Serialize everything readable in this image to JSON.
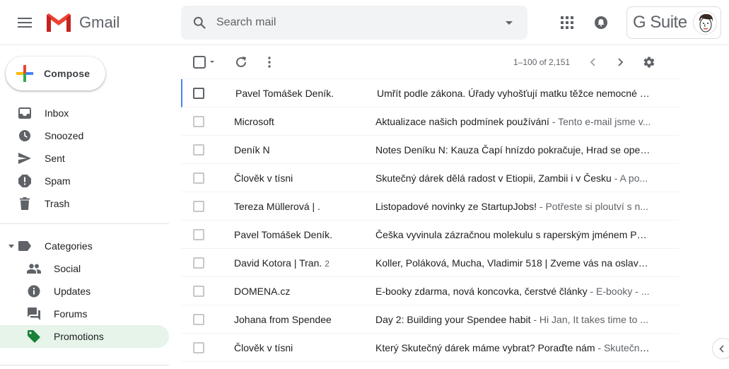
{
  "header": {
    "logo_text": "Gmail",
    "search_placeholder": "Search mail",
    "gsuite_label": "G Suite"
  },
  "compose": {
    "label": "Compose"
  },
  "sidebar": {
    "items": [
      {
        "label": "Inbox",
        "icon": "inbox-icon"
      },
      {
        "label": "Snoozed",
        "icon": "clock-icon"
      },
      {
        "label": "Sent",
        "icon": "send-icon"
      },
      {
        "label": "Spam",
        "icon": "spam-icon"
      },
      {
        "label": "Trash",
        "icon": "trash-icon"
      }
    ],
    "categories_label": "Categories",
    "categories": [
      {
        "label": "Social",
        "icon": "people-icon"
      },
      {
        "label": "Updates",
        "icon": "info-icon"
      },
      {
        "label": "Forums",
        "icon": "forum-icon"
      },
      {
        "label": "Promotions",
        "icon": "tag-icon",
        "active": true
      }
    ]
  },
  "toolbar": {
    "pager": "1–100 of 2,151"
  },
  "colors": {
    "accent_blue": "#4285f4",
    "promotions_green": "#188038",
    "active_bg": "#e6f4ea"
  },
  "emails": [
    {
      "sender": "Pavel Tomášek Deník.",
      "count": "",
      "subject": "Umřít podle zákona. Úřady vyhošťují matku těžce nemocné č...",
      "snippet": ""
    },
    {
      "sender": "Microsoft",
      "count": "",
      "subject": "Aktualizace našich podmínek používání",
      "snippet": " - Tento e-mail jsme v..."
    },
    {
      "sender": "Deník N",
      "count": "",
      "subject": "Notes Deníku N: Kauza Čapí hnízdo pokračuje, Hrad se opev...",
      "snippet": ""
    },
    {
      "sender": "Člověk v tísni",
      "count": "",
      "subject": "Skutečný dárek dělá radost v Etiopii, Zambii i v Česku",
      "snippet": " - A po..."
    },
    {
      "sender": "Tereza Müllerová | .",
      "count": "",
      "subject": "Listopadové novinky ze StartupJobs!",
      "snippet": " - Potřeste si ploutví s n..."
    },
    {
      "sender": "Pavel Tomášek Deník.",
      "count": "",
      "subject": "Češka vyvinula zázračnou molekulu s raperským jménem PS...",
      "snippet": ""
    },
    {
      "sender": "David Kotora | Tran.",
      "count": "2",
      "subject": "Koller, Poláková, Mucha, Vladimir 518 | Zveme vás na oslavu ...",
      "snippet": ""
    },
    {
      "sender": "DOMENA.cz",
      "count": "",
      "subject": "E-booky zdarma, nová koncovka, čerstvé články",
      "snippet": " - E-booky - ..."
    },
    {
      "sender": "Johana from Spendee",
      "count": "",
      "subject": "Day 2: Building your Spendee habit",
      "snippet": " - Hi Jan, It takes time to ..."
    },
    {
      "sender": "Člověk v tísni",
      "count": "",
      "subject": "Který Skutečný dárek máme vybrat? Poraďte nám",
      "snippet": " - Skutečný..."
    }
  ]
}
